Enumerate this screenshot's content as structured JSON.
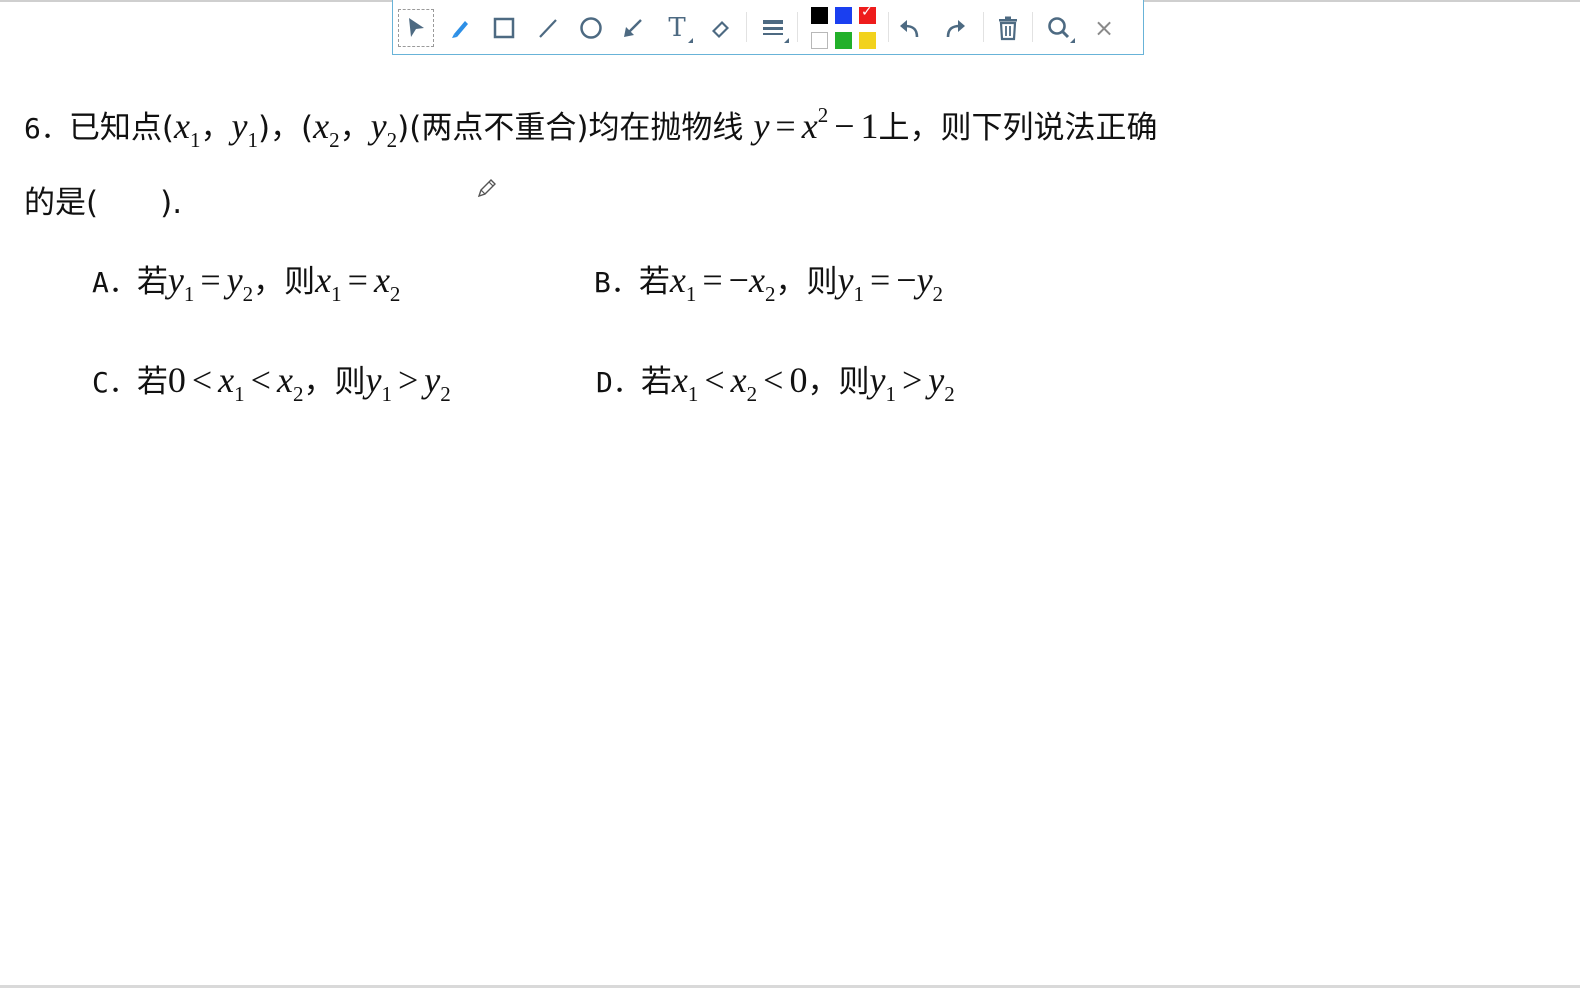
{
  "toolbar": {
    "tools": [
      "select-tool",
      "pen-tool",
      "rectangle-tool",
      "line-tool",
      "circle-tool",
      "arrow-tool",
      "text-tool",
      "eraser-tool",
      "line-width-tool",
      "undo",
      "redo",
      "clear-all",
      "zoom-tool",
      "close"
    ],
    "text_tool_label": "T",
    "close_label": "×",
    "colors": [
      "#000000",
      "#1a3ff0",
      "#ee1c1c",
      "#ffffff",
      "#22b02a",
      "#f2d21c"
    ],
    "selected_color": "#ee1c1c",
    "check_mark": "✓"
  },
  "question": {
    "number": "6．",
    "stem_part1": "已知点",
    "lparen": "(",
    "rparen": ")",
    "comma": "，",
    "note": "(两点不重合)",
    "stem_part2": "均在抛物线",
    "eq_y": "y",
    "eq_equals": "=",
    "eq_x": "x",
    "eq_exponent": "2",
    "eq_minus": "−",
    "eq_one": "1",
    "stem_part3": "上，则下列说法正确",
    "stem_line2": "的是(　　).",
    "var_x": "x",
    "var_y": "y",
    "sub1": "1",
    "sub2": "2"
  },
  "options": {
    "A": {
      "label": "A．",
      "if": "若",
      "then": "则",
      "comma": "，"
    },
    "B": {
      "label": "B．",
      "if": "若",
      "then": "则",
      "comma": "，",
      "neg": "−"
    },
    "C": {
      "label": "C．",
      "if": "若",
      "then": "则",
      "comma": "，",
      "zero": "0",
      "lt": "<",
      "gt": ">"
    },
    "D": {
      "label": "D．",
      "if": "若",
      "then": "则",
      "comma": "，",
      "zero": "0",
      "lt": "<",
      "gt": ">"
    },
    "equals": "="
  }
}
